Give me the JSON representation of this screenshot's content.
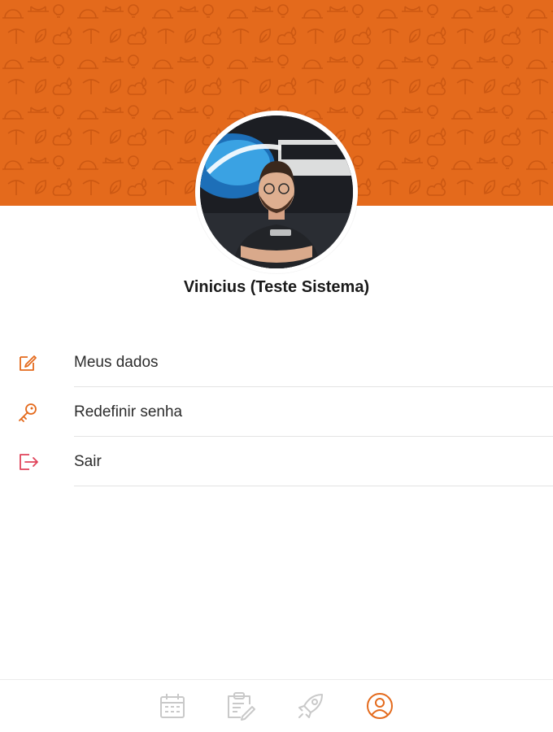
{
  "header": {
    "banner_color": "#e46a1c",
    "pattern_icon": "industry-pattern"
  },
  "profile": {
    "name": "Vinicius (Teste Sistema)",
    "avatar_icon": "user-photo"
  },
  "menu": {
    "items": [
      {
        "label": "Meus dados",
        "icon": "edit-icon",
        "icon_color": "#e46a1c"
      },
      {
        "label": "Redefinir senha",
        "icon": "key-icon",
        "icon_color": "#e46a1c"
      },
      {
        "label": "Sair",
        "icon": "logout-icon",
        "icon_color": "#e0435a"
      }
    ]
  },
  "bottom_nav": {
    "items": [
      {
        "icon": "calendar-icon",
        "active": false
      },
      {
        "icon": "clipboard-edit-icon",
        "active": false
      },
      {
        "icon": "rocket-icon",
        "active": false
      },
      {
        "icon": "user-circle-icon",
        "active": true
      }
    ],
    "active_color": "#e46a1c",
    "inactive_color": "#c9c9c9"
  }
}
